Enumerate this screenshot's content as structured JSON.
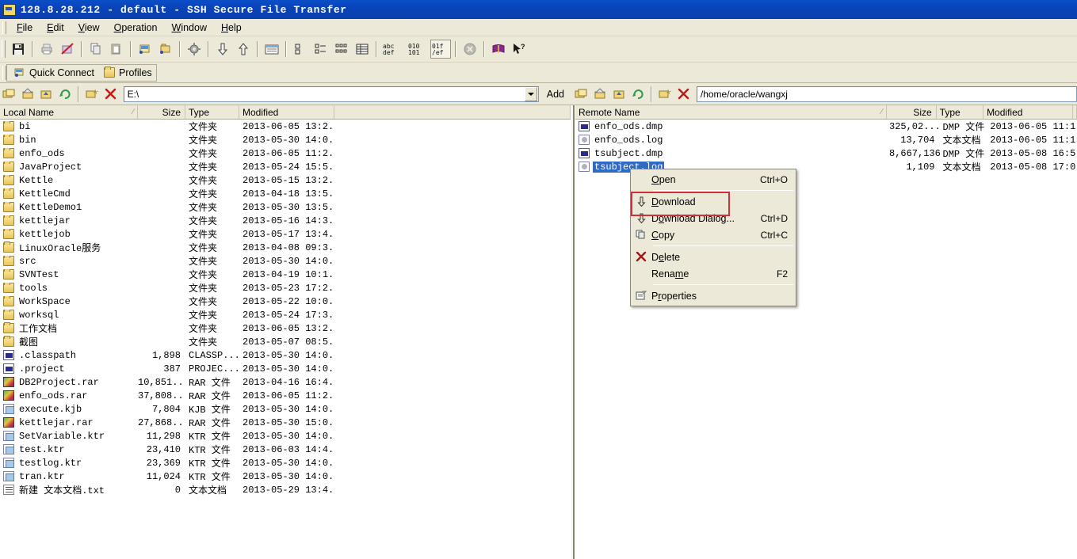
{
  "window": {
    "title": "128.8.28.212 - default - SSH Secure File Transfer",
    "icon": "app-icon"
  },
  "menubar": {
    "items": [
      {
        "label": "File",
        "accel": "F"
      },
      {
        "label": "Edit",
        "accel": "E"
      },
      {
        "label": "View",
        "accel": "V"
      },
      {
        "label": "Operation",
        "accel": "O"
      },
      {
        "label": "Window",
        "accel": "W"
      },
      {
        "label": "Help",
        "accel": "H"
      }
    ]
  },
  "toolbar": {
    "buttons": [
      {
        "name": "save-icon",
        "glyph": "💾"
      },
      {
        "name": "print-icon",
        "glyph": "🖨"
      },
      {
        "name": "print-preview-disabled-icon",
        "glyph": "🖨"
      },
      {
        "name": "copy-icon",
        "glyph": "⎘"
      },
      {
        "name": "paste-icon",
        "glyph": "📋"
      },
      {
        "name": "new-terminal-icon",
        "glyph": "🖥"
      },
      {
        "name": "new-file-transfer-icon",
        "glyph": "📁"
      },
      {
        "name": "connect-icon",
        "glyph": "⚙"
      },
      {
        "name": "download-icon",
        "glyph": "⇩"
      },
      {
        "name": "upload-icon",
        "glyph": "⇧"
      },
      {
        "name": "transfer-window-icon",
        "glyph": "▤"
      },
      {
        "name": "list-view-icon",
        "glyph": "☷"
      },
      {
        "name": "small-icons-view-icon",
        "glyph": "⁙"
      },
      {
        "name": "details-view-icon",
        "glyph": "☰"
      },
      {
        "name": "report-view-icon",
        "glyph": "≡"
      },
      {
        "name": "ascii-transfer-icon",
        "glyph": "abc"
      },
      {
        "name": "binary-transfer-icon",
        "glyph": "010"
      },
      {
        "name": "auto-transfer-icon",
        "glyph": "01"
      },
      {
        "name": "stop-icon",
        "glyph": "✖"
      },
      {
        "name": "help-book-icon",
        "glyph": "📕"
      },
      {
        "name": "context-help-icon",
        "glyph": "↖?"
      }
    ]
  },
  "connectbar": {
    "quick_connect": "Quick Connect",
    "profiles": "Profiles"
  },
  "local_address": {
    "value": "E:\\",
    "add_label": "Add",
    "buttons": [
      {
        "name": "parent-folder-icon"
      },
      {
        "name": "home-folder-icon"
      },
      {
        "name": "up-folder-icon"
      },
      {
        "name": "refresh-icon"
      },
      {
        "name": "new-folder-icon"
      },
      {
        "name": "delete-icon"
      }
    ]
  },
  "remote_address": {
    "value": "/home/oracle/wangxj",
    "buttons": [
      {
        "name": "parent-folder-icon"
      },
      {
        "name": "home-folder-icon"
      },
      {
        "name": "up-folder-icon"
      },
      {
        "name": "refresh-icon"
      },
      {
        "name": "new-folder-icon"
      },
      {
        "name": "delete-icon"
      }
    ]
  },
  "local_pane": {
    "headers": {
      "name": "Local Name",
      "size": "Size",
      "type": "Type",
      "modified": "Modified"
    },
    "sort_indicator": "⁄",
    "rows": [
      {
        "icon": "folder",
        "name": "bi",
        "size": "",
        "type": "文件夹",
        "modified": "2013-06-05 13:2..."
      },
      {
        "icon": "folder",
        "name": "bin",
        "size": "",
        "type": "文件夹",
        "modified": "2013-05-30 14:0..."
      },
      {
        "icon": "folder",
        "name": "enfo_ods",
        "size": "",
        "type": "文件夹",
        "modified": "2013-06-05 11:2..."
      },
      {
        "icon": "folder",
        "name": "JavaProject",
        "size": "",
        "type": "文件夹",
        "modified": "2013-05-24 15:5..."
      },
      {
        "icon": "folder",
        "name": "Kettle",
        "size": "",
        "type": "文件夹",
        "modified": "2013-05-15 13:2..."
      },
      {
        "icon": "folder",
        "name": "KettleCmd",
        "size": "",
        "type": "文件夹",
        "modified": "2013-04-18 13:5..."
      },
      {
        "icon": "folder",
        "name": "KettleDemo1",
        "size": "",
        "type": "文件夹",
        "modified": "2013-05-30 13:5..."
      },
      {
        "icon": "folder",
        "name": "kettlejar",
        "size": "",
        "type": "文件夹",
        "modified": "2013-05-16 14:3..."
      },
      {
        "icon": "folder",
        "name": "kettlejob",
        "size": "",
        "type": "文件夹",
        "modified": "2013-05-17 13:4..."
      },
      {
        "icon": "folder",
        "name": "LinuxOracle服务",
        "size": "",
        "type": "文件夹",
        "modified": "2013-04-08 09:3..."
      },
      {
        "icon": "folder",
        "name": "src",
        "size": "",
        "type": "文件夹",
        "modified": "2013-05-30 14:0..."
      },
      {
        "icon": "folder",
        "name": "SVNTest",
        "size": "",
        "type": "文件夹",
        "modified": "2013-04-19 10:1..."
      },
      {
        "icon": "folder",
        "name": "tools",
        "size": "",
        "type": "文件夹",
        "modified": "2013-05-23 17:2..."
      },
      {
        "icon": "folder",
        "name": "WorkSpace",
        "size": "",
        "type": "文件夹",
        "modified": "2013-05-22 10:0..."
      },
      {
        "icon": "folder",
        "name": "worksql",
        "size": "",
        "type": "文件夹",
        "modified": "2013-05-24 17:3..."
      },
      {
        "icon": "folder",
        "name": "工作文档",
        "size": "",
        "type": "文件夹",
        "modified": "2013-06-05 13:2..."
      },
      {
        "icon": "folder",
        "name": "截图",
        "size": "",
        "type": "文件夹",
        "modified": "2013-05-07 08:5..."
      },
      {
        "icon": "xml",
        "name": ".classpath",
        "size": "1,898",
        "type": "CLASSP...",
        "modified": "2013-05-30 14:0..."
      },
      {
        "icon": "xml",
        "name": ".project",
        "size": "387",
        "type": "PROJEC...",
        "modified": "2013-05-30 14:0..."
      },
      {
        "icon": "rar",
        "name": "DB2Project.rar",
        "size": "10,851...",
        "type": "RAR 文件",
        "modified": "2013-04-16 16:4..."
      },
      {
        "icon": "rar",
        "name": "enfo_ods.rar",
        "size": "37,808...",
        "type": "RAR 文件",
        "modified": "2013-06-05 11:2..."
      },
      {
        "icon": "ktr",
        "name": "execute.kjb",
        "size": "7,804",
        "type": "KJB 文件",
        "modified": "2013-05-30 14:0..."
      },
      {
        "icon": "rar",
        "name": "kettlejar.rar",
        "size": "27,868...",
        "type": "RAR 文件",
        "modified": "2013-05-30 15:0..."
      },
      {
        "icon": "ktr",
        "name": "SetVariable.ktr",
        "size": "11,298",
        "type": "KTR 文件",
        "modified": "2013-05-30 14:0..."
      },
      {
        "icon": "ktr",
        "name": "test.ktr",
        "size": "23,410",
        "type": "KTR 文件",
        "modified": "2013-06-03 14:4..."
      },
      {
        "icon": "ktr",
        "name": "testlog.ktr",
        "size": "23,369",
        "type": "KTR 文件",
        "modified": "2013-05-30 14:0..."
      },
      {
        "icon": "ktr",
        "name": "tran.ktr",
        "size": "11,024",
        "type": "KTR 文件",
        "modified": "2013-05-30 14:0..."
      },
      {
        "icon": "txt",
        "name": "新建 文本文档.txt",
        "size": "0",
        "type": "文本文档",
        "modified": "2013-05-29 13:4..."
      }
    ]
  },
  "remote_pane": {
    "headers": {
      "name": "Remote Name",
      "size": "Size",
      "type": "Type",
      "modified": "Modified"
    },
    "sort_indicator": "⁄",
    "rows": [
      {
        "icon": "xml",
        "name": "enfo_ods.dmp",
        "size": "325,02...",
        "type": "DMP 文件",
        "modified": "2013-06-05 11:1...",
        "selected": false
      },
      {
        "icon": "log",
        "name": "enfo_ods.log",
        "size": "13,704",
        "type": "文本文档",
        "modified": "2013-06-05 11:1...",
        "selected": false
      },
      {
        "icon": "xml",
        "name": "tsubject.dmp",
        "size": "8,667,136",
        "type": "DMP 文件",
        "modified": "2013-05-08 16:5...",
        "selected": false
      },
      {
        "icon": "log",
        "name": "tsubject.log",
        "size": "1,109",
        "type": "文本文档",
        "modified": "2013-05-08 17:0...",
        "selected": true
      }
    ]
  },
  "context_menu": {
    "highlight_color": "#d03038",
    "items": [
      {
        "label": "Open",
        "accel": "Ctrl+O",
        "icon": "",
        "separator_after": true,
        "highlighted": false
      },
      {
        "label": "Download",
        "accel": "",
        "icon": "download-arrow-icon",
        "separator_after": false,
        "highlighted": true
      },
      {
        "label": "Download Dialog...",
        "accel": "Ctrl+D",
        "icon": "download-arrow-icon",
        "separator_after": false,
        "highlighted": false
      },
      {
        "label": "Copy",
        "accel": "Ctrl+C",
        "icon": "copy-icon",
        "separator_after": true,
        "highlighted": false
      },
      {
        "label": "Delete",
        "accel": "",
        "icon": "delete-x-icon",
        "separator_after": false,
        "highlighted": false
      },
      {
        "label": "Rename",
        "accel": "F2",
        "icon": "",
        "separator_after": true,
        "highlighted": false
      },
      {
        "label": "Properties",
        "accel": "",
        "icon": "properties-icon",
        "separator_after": false,
        "highlighted": false
      }
    ]
  },
  "colors": {
    "titlebar": "#0a46bd",
    "chrome": "#ece9d8",
    "selection": "#316ac5",
    "accent_red": "#d03038"
  }
}
